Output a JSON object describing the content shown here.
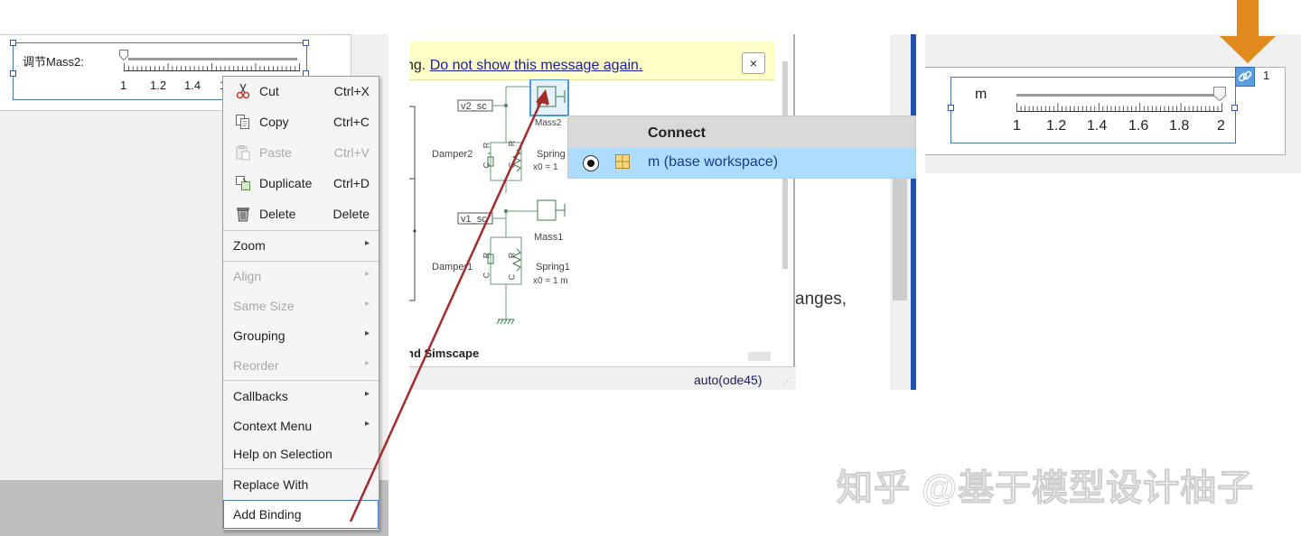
{
  "colors": {
    "slider_border": "#4472c4",
    "menu_highlight_border": "#4a7bd0",
    "banner_bg": "#ffffc8",
    "connect_row_bg": "#aedcff",
    "arrow_red": "#a52a2a",
    "arrow_orange": "#e08a1e",
    "link_button": "#5a9ee0"
  },
  "panel1": {
    "slider": {
      "label": "调节Mass2:",
      "tick_labels": [
        "1",
        "1.2",
        "1.4",
        "1"
      ]
    },
    "context_menu": {
      "items": [
        {
          "label": "Cut",
          "shortcut": "Ctrl+X",
          "icon": "scissors-icon",
          "enabled": true
        },
        {
          "label": "Copy",
          "shortcut": "Ctrl+C",
          "icon": "copy-icon",
          "enabled": true
        },
        {
          "label": "Paste",
          "shortcut": "Ctrl+V",
          "icon": "paste-icon",
          "enabled": false
        },
        {
          "label": "Duplicate",
          "shortcut": "Ctrl+D",
          "icon": "duplicate-icon",
          "enabled": true
        },
        {
          "label": "Delete",
          "shortcut": "Delete",
          "icon": "trash-icon",
          "enabled": true
        },
        {
          "label": "Zoom",
          "submenu": true,
          "enabled": true
        },
        {
          "label": "Align",
          "submenu": true,
          "enabled": false
        },
        {
          "label": "Same Size",
          "submenu": true,
          "enabled": false
        },
        {
          "label": "Grouping",
          "submenu": true,
          "enabled": true
        },
        {
          "label": "Reorder",
          "submenu": true,
          "enabled": false
        },
        {
          "label": "Callbacks",
          "submenu": true,
          "enabled": true
        },
        {
          "label": "Context Menu",
          "submenu": true,
          "enabled": true
        },
        {
          "label": "Help on Selection",
          "enabled": true
        },
        {
          "label": "Replace With",
          "enabled": true
        },
        {
          "label": "Add Binding",
          "enabled": true,
          "highlighted": true
        }
      ]
    }
  },
  "panel2": {
    "banner": {
      "prefix": "ng. ",
      "link": "Do not show this message again.",
      "close": "×"
    },
    "blocks": {
      "v2_sc": "v2_sc",
      "v1_sc": "v1_sc",
      "mass2": "Mass2",
      "mass1": "Mass1",
      "damper2": "Damper2",
      "damper1": "Damper1",
      "spring2": "Spring",
      "spring2_param": "x0 = 1",
      "spring1": "Spring1",
      "spring1_param": "x0 = 1 m",
      "c_label": "C",
      "r_label": "R"
    },
    "bottom_label": "nd Simscape",
    "status": "auto(ode45)"
  },
  "connect_popup": {
    "title": "Connect",
    "item": "m (base workspace)",
    "selected": true
  },
  "partial_text": "anges,",
  "panel4": {
    "slider": {
      "label": "m",
      "tick_labels": [
        "1",
        "1.2",
        "1.4",
        "1.6",
        "1.8",
        "2"
      ]
    },
    "link_count": "1"
  },
  "watermark": "知乎 @基于模型设计柚子"
}
